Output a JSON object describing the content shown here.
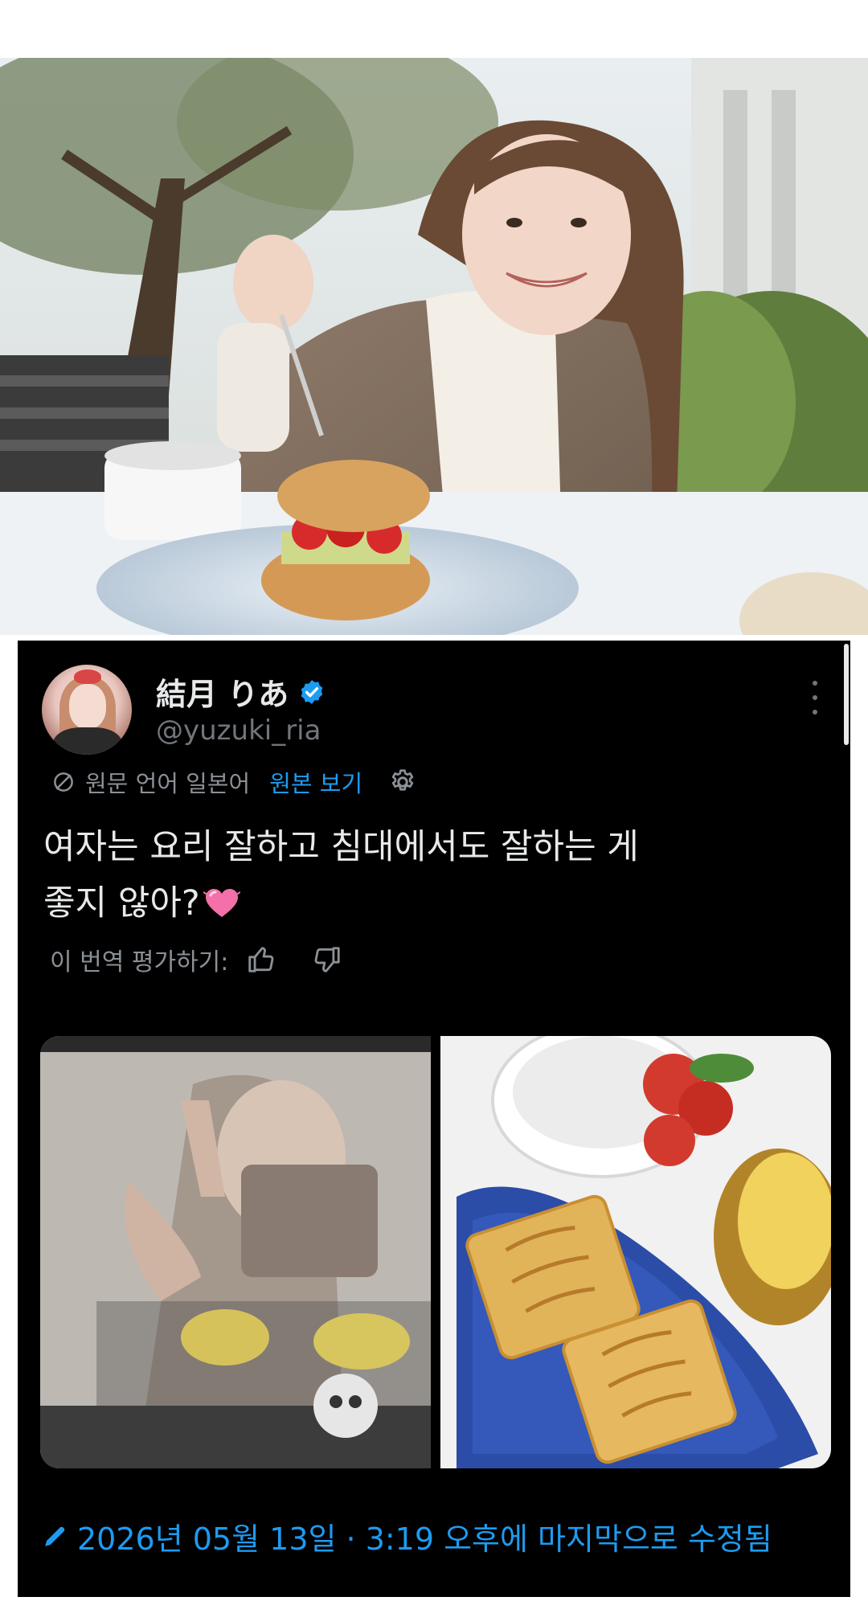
{
  "tweet": {
    "display_name": "結月 りあ",
    "handle": "@yuzuki_ria",
    "translation": {
      "source_label": "원문 언어 일본어",
      "view_original": "원본 보기"
    },
    "text_line1": "여자는 요리 잘하고 침대에서도 잘하는 게",
    "text_line2": "좋지 않아?",
    "rate_label": "이 번역 평가하기:",
    "edited_label": "2026년 05월 13일 · 3:19 오후에 마지막으로 수정됨"
  },
  "icons": {
    "verified": "verified-badge-icon",
    "more": "more-dots-icon",
    "globe": "translate-icon",
    "settings": "gear-icon",
    "thumb_up": "thumb-up-icon",
    "thumb_down": "thumb-down-icon",
    "pencil": "pencil-icon",
    "heart": "pink-heart-emoji"
  },
  "colors": {
    "background": "#000000",
    "text": "#e7e9ea",
    "muted": "#71767b",
    "accent": "#1d9bf0",
    "verified": "#1d9bf0"
  }
}
